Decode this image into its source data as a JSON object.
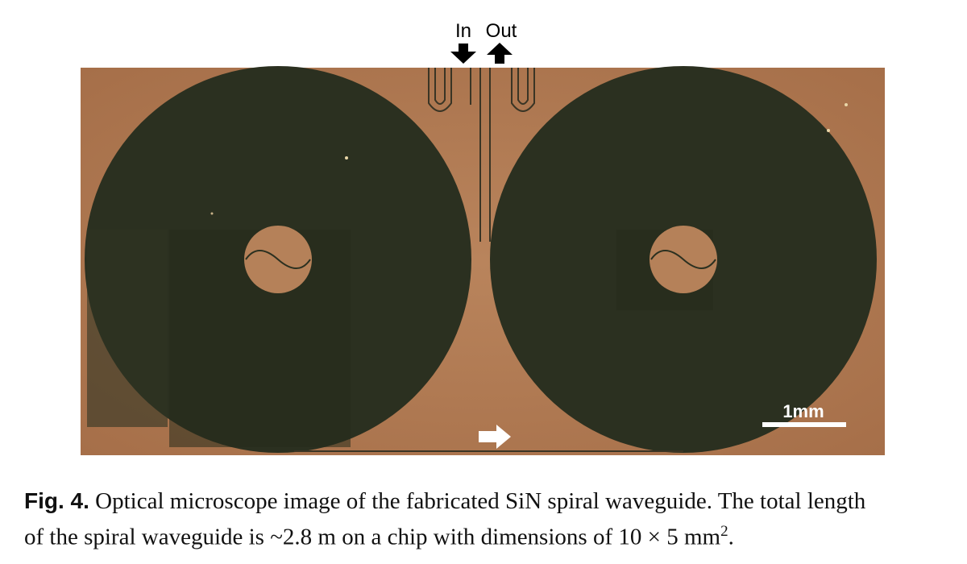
{
  "figure": {
    "labels": {
      "in": "In",
      "out": "Out",
      "scale": "1mm"
    },
    "colors": {
      "chip_background": "#b07a52",
      "spiral": "#2b3020",
      "arrow_top": "#000000",
      "arrow_bottom": "#ffffff",
      "scale_bar": "#ffffff"
    }
  },
  "caption": {
    "label": "Fig. 4.",
    "line1": "Optical microscope image of the fabricated SiN spiral waveguide. The total length",
    "line2_text": "of the spiral waveguide is ~2.8 m on a chip with dimensions of 10 × 5 mm",
    "line2_sup": "2",
    "line2_end": "."
  }
}
